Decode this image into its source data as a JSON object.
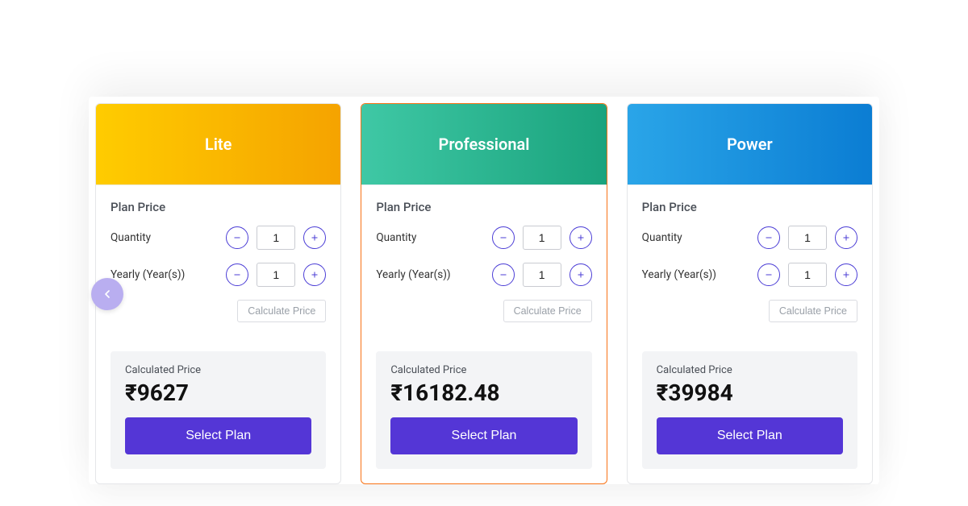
{
  "labels": {
    "plan_price": "Plan Price",
    "quantity": "Quantity",
    "yearly": "Yearly (Year(s))",
    "calculate": "Calculate Price",
    "calculated": "Calculated Price",
    "select": "Select Plan"
  },
  "plans": [
    {
      "name": "Lite",
      "quantity": "1",
      "years": "1",
      "price": "₹9627"
    },
    {
      "name": "Professional",
      "quantity": "1",
      "years": "1",
      "price": "₹16182.48"
    },
    {
      "name": "Power",
      "quantity": "1",
      "years": "1",
      "price": "₹39984"
    }
  ]
}
